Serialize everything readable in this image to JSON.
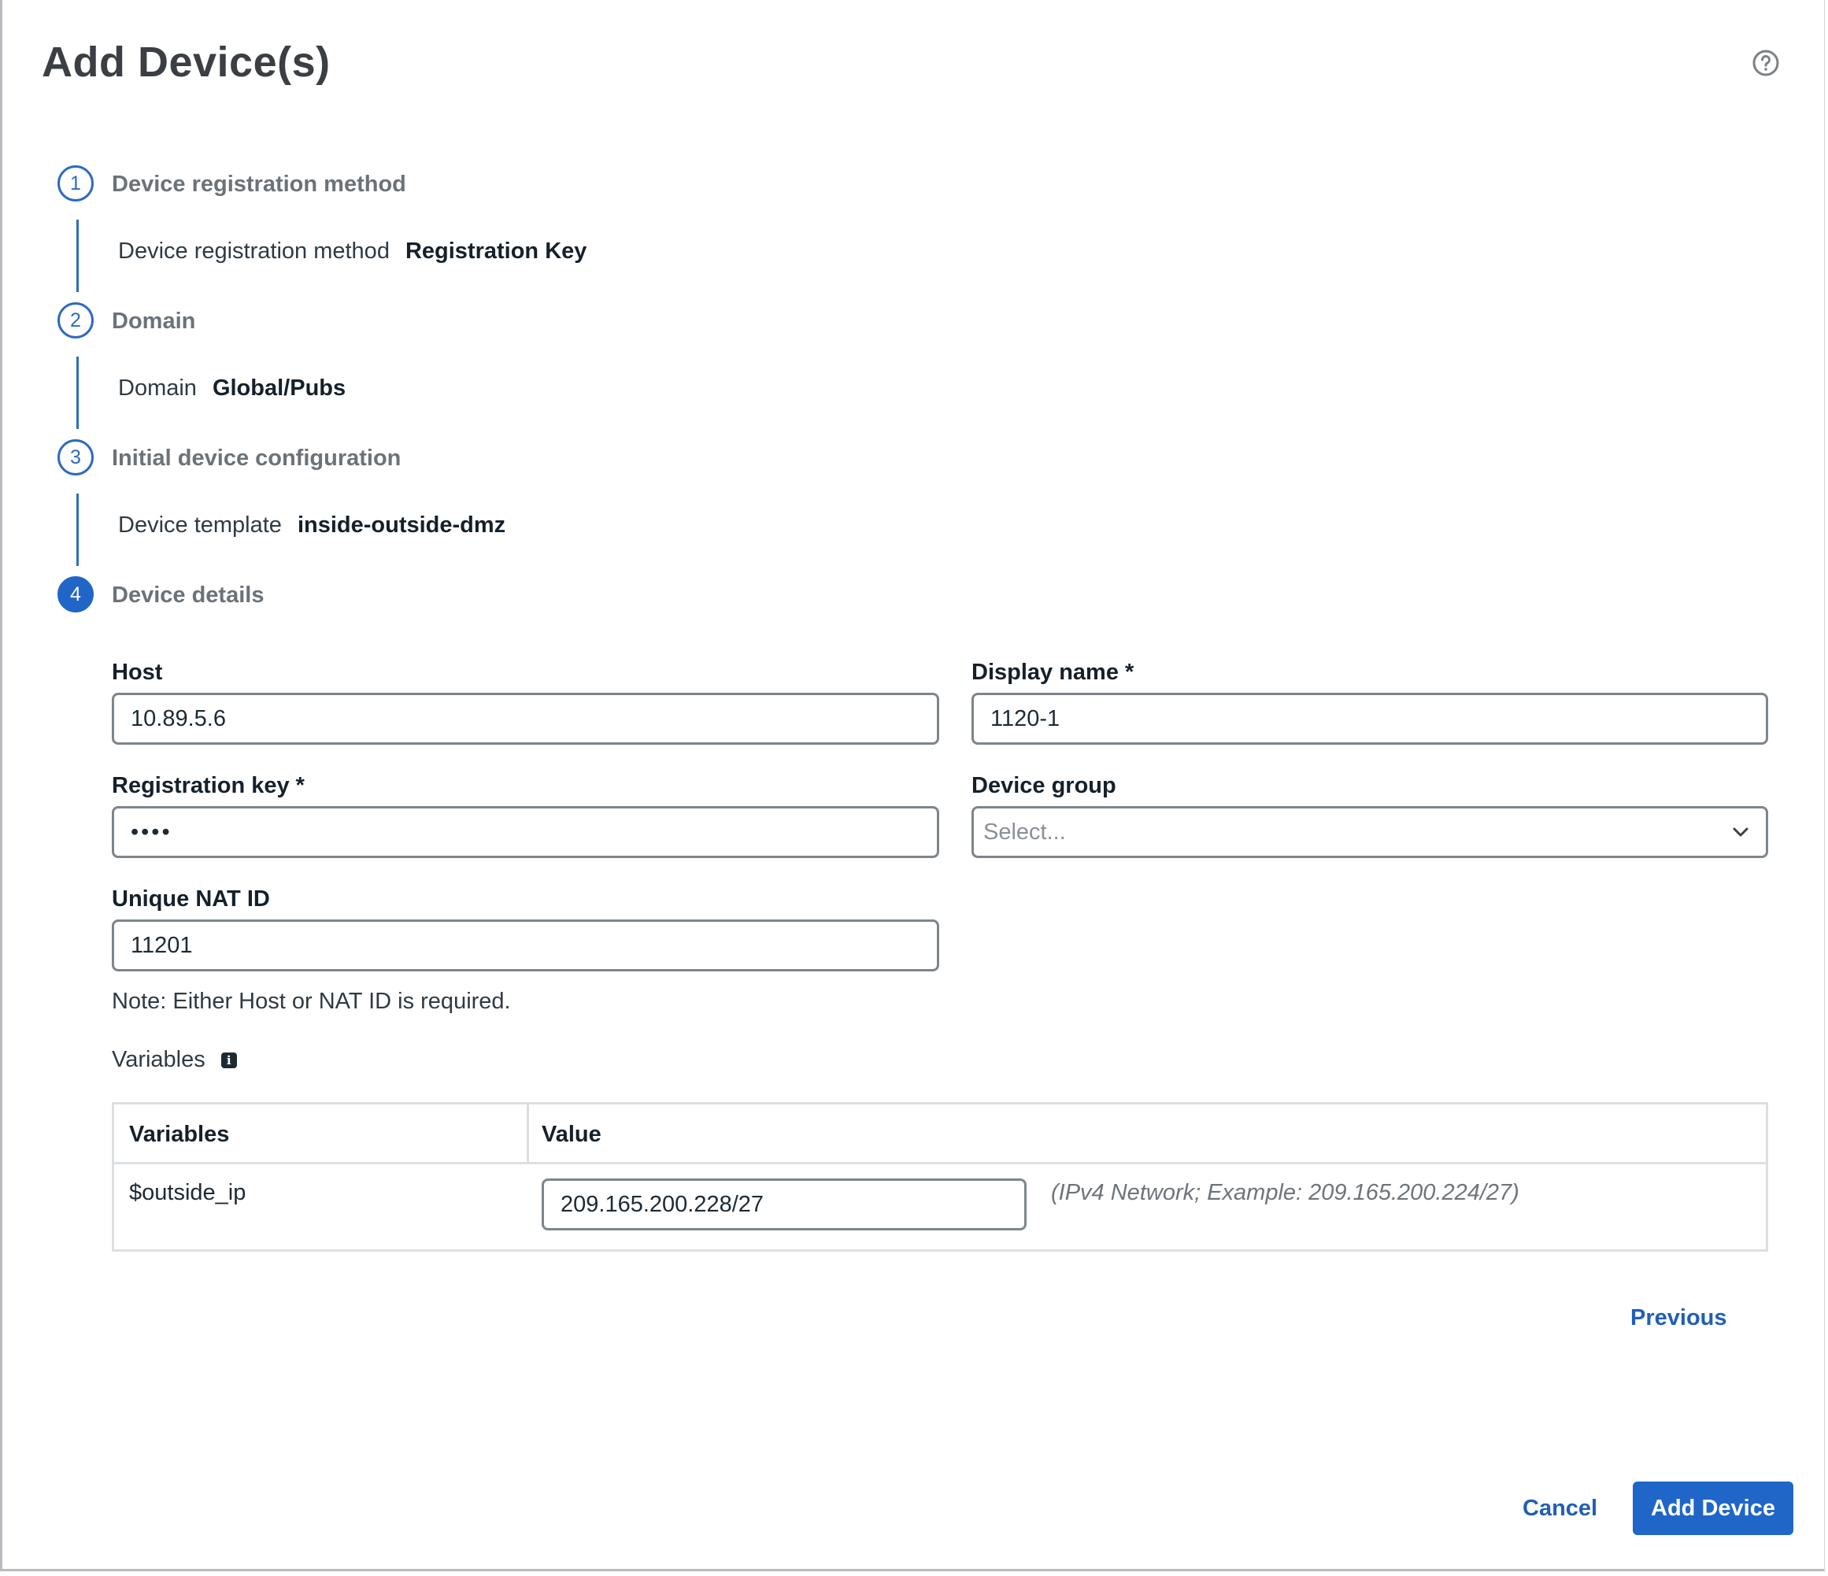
{
  "dialog": {
    "title": "Add Device(s)"
  },
  "steps": [
    {
      "number": "1",
      "title": "Device registration method",
      "summary_label": "Device registration method",
      "summary_value": "Registration Key"
    },
    {
      "number": "2",
      "title": "Domain",
      "summary_label": "Domain",
      "summary_value": "Global/Pubs"
    },
    {
      "number": "3",
      "title": "Initial device configuration",
      "summary_label": "Device template",
      "summary_value": "inside-outside-dmz"
    },
    {
      "number": "4",
      "title": "Device details"
    }
  ],
  "form": {
    "host": {
      "label": "Host",
      "value": "10.89.5.6"
    },
    "display_name": {
      "label": "Display name *",
      "value": "1120-1"
    },
    "registration_key": {
      "label": "Registration key *",
      "value": "••••"
    },
    "device_group": {
      "label": "Device group",
      "placeholder": "Select..."
    },
    "nat_id": {
      "label": "Unique NAT ID",
      "value": "11201"
    },
    "note": "Note: Either Host or NAT ID is required.",
    "variables_label": "Variables"
  },
  "variables_table": {
    "headers": [
      "Variables",
      "Value"
    ],
    "rows": [
      {
        "variable": "$outside_ip",
        "value": "209.165.200.228/27",
        "hint": "(IPv4 Network; Example: 209.165.200.224/27)"
      }
    ]
  },
  "buttons": {
    "previous": "Previous",
    "cancel": "Cancel",
    "add_device": "Add Device"
  },
  "colors": {
    "primary": "#1f66c8",
    "link": "#1f5fb8",
    "step_accent": "#2e6bbf"
  }
}
